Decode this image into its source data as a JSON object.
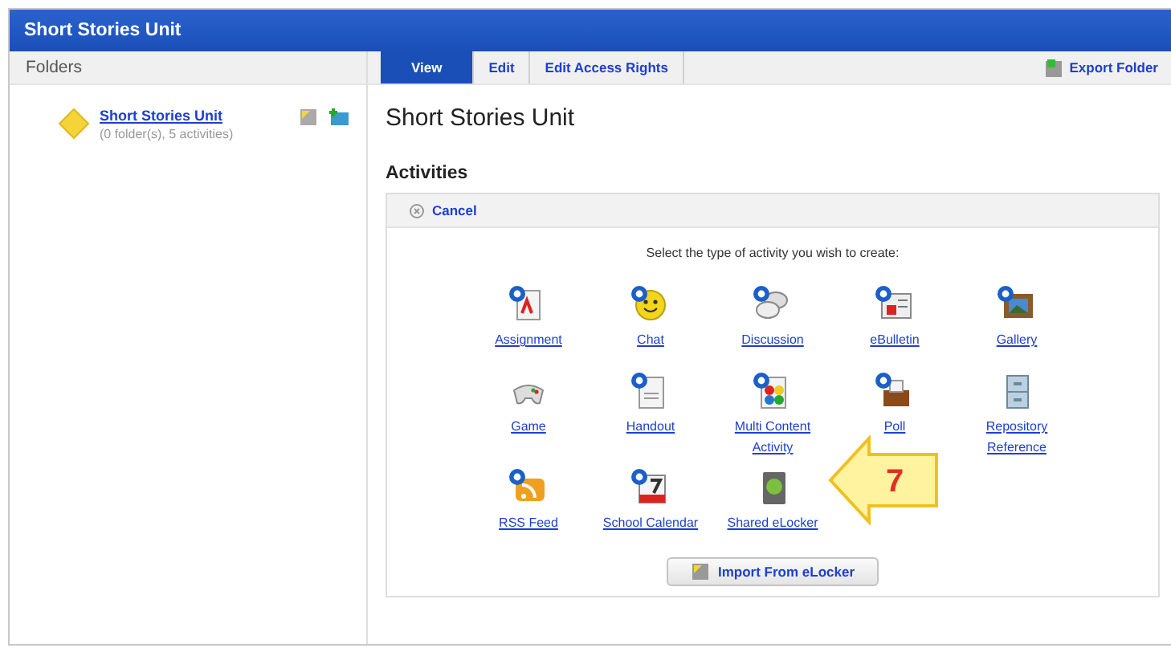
{
  "window": {
    "title": "Short Stories Unit"
  },
  "sidebar": {
    "header": "Folders",
    "folder": {
      "name": "Short Stories Unit",
      "summary": "(0 folder(s), 5 activities)"
    }
  },
  "tabs": [
    {
      "label": "View",
      "selected": true
    },
    {
      "label": "Edit",
      "selected": false
    },
    {
      "label": "Edit Access Rights",
      "selected": false
    }
  ],
  "export_button": "Export Folder",
  "page_title": "Short Stories Unit",
  "section_title": "Activities",
  "cancel_link": "Cancel",
  "instruction": "Select the type of activity you wish to create:",
  "activities": [
    {
      "label": "Assignment",
      "kind": "assignment"
    },
    {
      "label": "Chat",
      "kind": "chat"
    },
    {
      "label": "Discussion",
      "kind": "discussion"
    },
    {
      "label": "eBulletin",
      "kind": "bulletin"
    },
    {
      "label": "Gallery",
      "kind": "gallery"
    },
    {
      "label": "Game",
      "kind": "game"
    },
    {
      "label": "Handout",
      "kind": "handout"
    },
    {
      "label": "Multi Content Activity",
      "kind": "multi"
    },
    {
      "label": "Poll",
      "kind": "poll"
    },
    {
      "label": "Repository Reference",
      "kind": "repository"
    },
    {
      "label": "RSS Feed",
      "kind": "rss"
    },
    {
      "label": "School Calendar",
      "kind": "calendar"
    },
    {
      "label": "Shared eLocker",
      "kind": "locker"
    }
  ],
  "import_button": "Import From eLocker",
  "callout": {
    "number": "7"
  }
}
